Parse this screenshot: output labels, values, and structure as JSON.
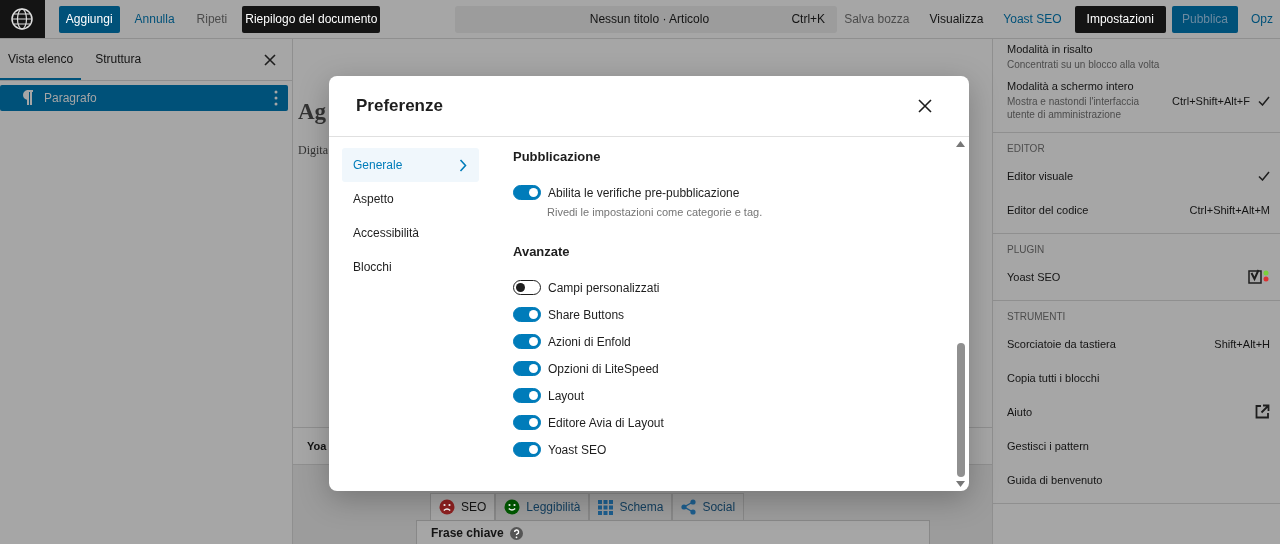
{
  "top_bar": {
    "items": [
      {
        "kind": "primary",
        "label": "Aggiungi"
      },
      {
        "kind": "link",
        "label": "Annulla"
      },
      {
        "kind": "muted",
        "label": "Ripeti"
      },
      {
        "kind": "tooltip",
        "label": "Riepilogo del documento"
      }
    ],
    "command": {
      "title": "Nessun titolo · Articolo",
      "shortcut": "Ctrl+K"
    },
    "actions": [
      {
        "kind": "muted",
        "label": "Salva bozza"
      },
      {
        "kind": "plain",
        "label": "Visualizza"
      },
      {
        "kind": "link",
        "label": "Yoast SEO"
      },
      {
        "kind": "dark",
        "label": "Impostazioni"
      },
      {
        "kind": "primary",
        "label": "Pubblica"
      },
      {
        "kind": "link",
        "label": "Opz"
      }
    ]
  },
  "list_panel": {
    "tabs": [
      {
        "label": "Vista elenco",
        "selected": true
      },
      {
        "label": "Struttura",
        "selected": false
      }
    ],
    "blocks": [
      {
        "label": "Paragrafo",
        "selected": true
      }
    ]
  },
  "editor": {
    "title": "Ag",
    "placeholder": "Digita",
    "metabox_title": "Yoa",
    "yoast_tabs": [
      {
        "label": "SEO",
        "color": "#8f2121",
        "selected": true
      },
      {
        "label": "Leggibilità",
        "color": "#005a00",
        "selected": false
      },
      {
        "label": "Schema",
        "selected": false
      },
      {
        "label": "Social",
        "selected": false
      }
    ],
    "field_label": "Frase chiave"
  },
  "options_menu": {
    "groups": [
      {
        "items": [
          {
            "kind": "item",
            "label": "Modalità in risalto",
            "description": "Concentrati su un blocco alla volta",
            "checked": false
          },
          {
            "kind": "item",
            "label": "Modalità a schermo intero",
            "description": "Mostra e nastondi l'interfaccia utente di amministrazione",
            "shortcut": "Ctrl+Shift+Alt+F",
            "checked": true
          }
        ]
      },
      {
        "title": "EDITOR",
        "items": [
          {
            "kind": "item",
            "label": "Editor visuale",
            "checked": true
          },
          {
            "kind": "item",
            "label": "Editor del codice",
            "shortcut": "Ctrl+Shift+Alt+M",
            "checked": false
          }
        ]
      },
      {
        "title": "PLUGIN",
        "items": [
          {
            "kind": "plugin",
            "label": "Yoast SEO",
            "checked": false
          }
        ]
      },
      {
        "title": "STRUMENTI",
        "items": [
          {
            "kind": "item",
            "label": "Scorciatoie da tastiera",
            "shortcut": "Shift+Alt+H",
            "checked": false
          },
          {
            "kind": "item",
            "label": "Copia tutti i blocchi",
            "checked": false
          },
          {
            "kind": "external",
            "label": "Aiuto",
            "checked": false
          },
          {
            "kind": "item",
            "label": "Gestisci i pattern",
            "checked": false
          },
          {
            "kind": "item",
            "label": "Guida di benvenuto",
            "checked": false
          }
        ]
      }
    ]
  },
  "modal": {
    "title": "Preferenze",
    "nav": [
      {
        "label": "Generale",
        "selected": true
      },
      {
        "label": "Aspetto",
        "selected": false
      },
      {
        "label": "Accessibilità",
        "selected": false
      },
      {
        "label": "Blocchi",
        "selected": false
      }
    ],
    "sections": [
      {
        "title": "Pubblicazione",
        "options": [
          {
            "label": "Abilita le verifiche pre-pubblicazione",
            "description": "Rivedi le impostazioni come categorie e tag.",
            "on": true
          }
        ]
      },
      {
        "title": "Avanzate",
        "options": [
          {
            "label": "Campi personalizzati",
            "on": false
          },
          {
            "label": "Share Buttons",
            "on": true
          },
          {
            "label": "Azioni di Enfold",
            "on": true
          },
          {
            "label": "Opzioni di LiteSpeed",
            "on": true
          },
          {
            "label": "Layout",
            "on": true
          },
          {
            "label": "Editore Avia di Layout",
            "on": true
          },
          {
            "label": "Yoast SEO",
            "on": true
          }
        ]
      }
    ]
  }
}
